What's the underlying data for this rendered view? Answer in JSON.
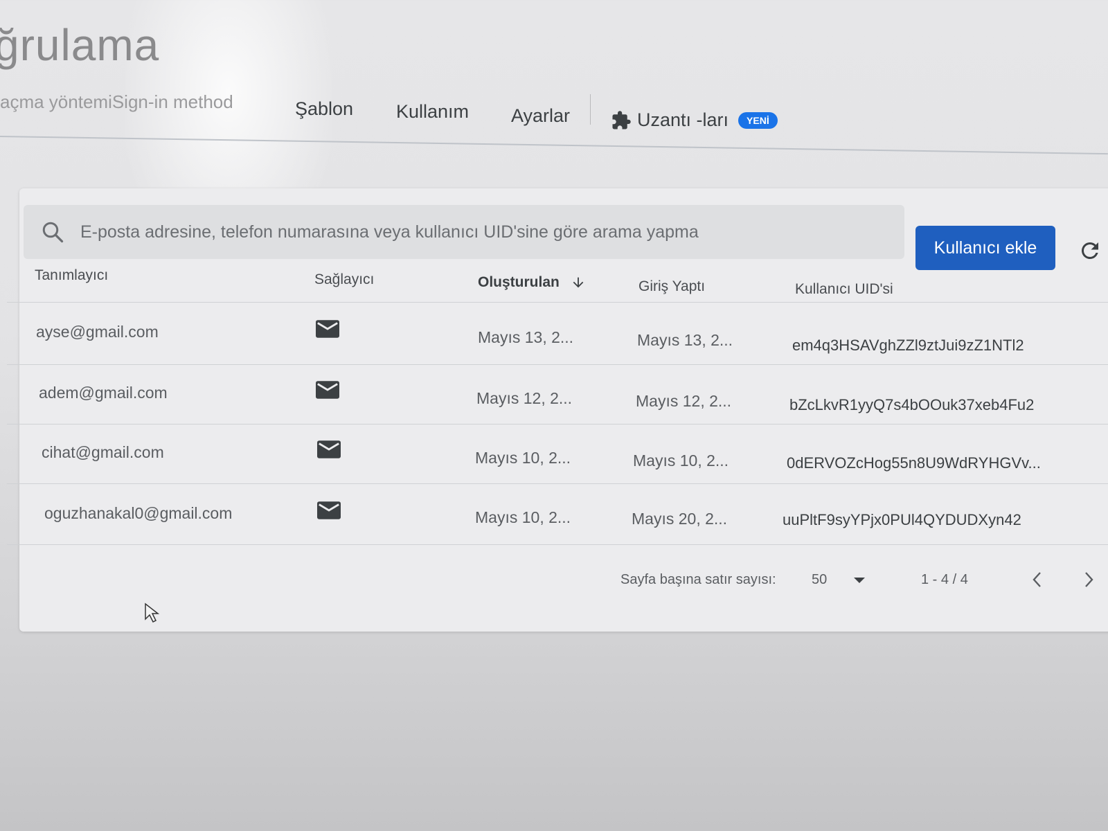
{
  "page": {
    "title": "ğrulama"
  },
  "tabs": [
    {
      "label": "açma yöntemiSign-in method"
    },
    {
      "label": "Şablon"
    },
    {
      "label": "Kullanım"
    },
    {
      "label": "Ayarlar"
    },
    {
      "label": "Uzantı -ları",
      "badge": "YENİ"
    }
  ],
  "search": {
    "placeholder": "E-posta adresine, telefon numarasına veya kullanıcı UID'sine göre arama yapma",
    "value": ""
  },
  "actions": {
    "add_user": "Kullanıcı ekle"
  },
  "table": {
    "columns": [
      "Tanımlayıcı",
      "Sağlayıcı",
      "Oluşturulan",
      "Giriş Yaptı",
      "Kullanıcı UID'si"
    ],
    "sorted_column": "Oluşturulan",
    "rows": [
      {
        "identifier": "ayse@gmail.com",
        "provider": "email",
        "created": "Mayıs 13, 2...",
        "signed_in": "Mayıs 13, 2...",
        "uid": "em4q3HSAVghZZl9ztJui9zZ1NTl2"
      },
      {
        "identifier": "adem@gmail.com",
        "provider": "email",
        "created": "Mayıs 12, 2...",
        "signed_in": "Mayıs 12, 2...",
        "uid": "bZcLkvR1yyQ7s4bOOuk37xeb4Fu2"
      },
      {
        "identifier": "cihat@gmail.com",
        "provider": "email",
        "created": "Mayıs 10, 2...",
        "signed_in": "Mayıs 10, 2...",
        "uid": "0dERVOZcHog55n8U9WdRYHGVv..."
      },
      {
        "identifier": "oguzhanakal0@gmail.com",
        "provider": "email",
        "created": "Mayıs 10, 2...",
        "signed_in": "Mayıs 20, 2...",
        "uid": "uuPltF9syYPjx0PUl4QYDUDXyn42"
      }
    ]
  },
  "pagination": {
    "rows_per_page_label": "Sayfa başına satır sayısı:",
    "rows_per_page": "50",
    "range": "1 - 4 / 4"
  },
  "icons": {
    "tab_extensions": "puzzle-icon",
    "search": "search-icon",
    "refresh": "refresh-icon",
    "provider": "mail-icon",
    "sort": "arrow-down-icon"
  },
  "colors": {
    "accent": "#1f5fbf",
    "badge": "#1a73e8"
  }
}
